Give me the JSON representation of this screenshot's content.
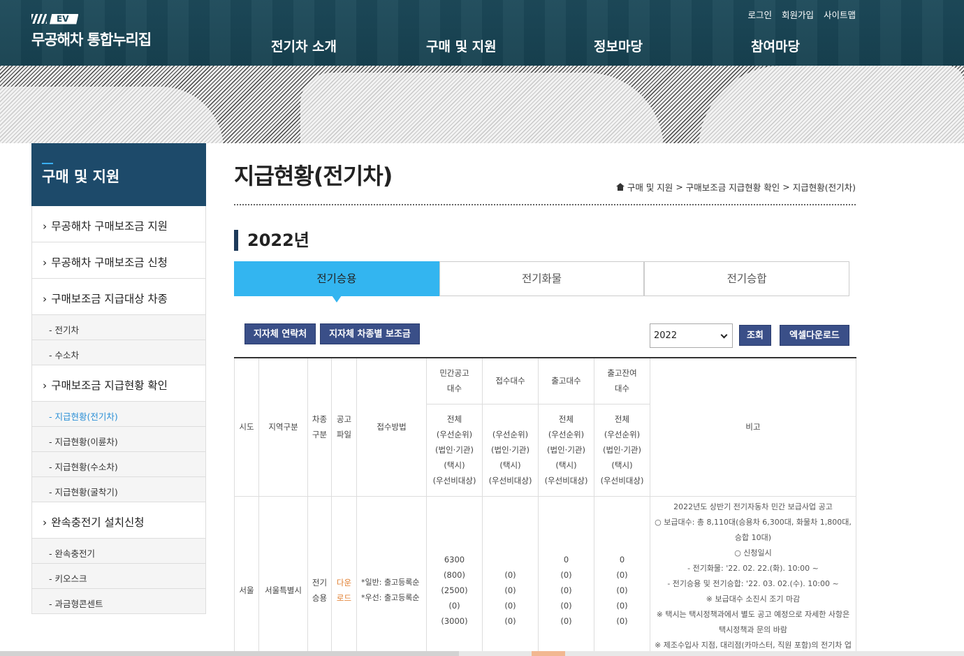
{
  "header": {
    "logo_badge": "EV",
    "logo_text": "무공해차 통합누리집",
    "util_links": [
      "로그인",
      "회원가입",
      "사이트맵"
    ],
    "gnb": [
      "전기차 소개",
      "구매 및 지원",
      "정보마당",
      "참여마당"
    ]
  },
  "sidebar": {
    "title": "구매 및 지원",
    "items": [
      {
        "label": "무공해차 구매보조금 지원"
      },
      {
        "label": "무공해차 구매보조금 신청"
      },
      {
        "label": "구매보조금 지급대상 차종"
      },
      {
        "label": "- 전기차"
      },
      {
        "label": "- 수소차"
      },
      {
        "label": "구매보조금 지급현황 확인"
      },
      {
        "label": "- 지급현황(전기차)"
      },
      {
        "label": "- 지급현황(이륜차)"
      },
      {
        "label": "- 지급현황(수소차)"
      },
      {
        "label": "- 지급현황(굴착기)"
      },
      {
        "label": "완속충전기 설치신청"
      },
      {
        "label": "- 완속충전기"
      },
      {
        "label": "- 키오스크"
      },
      {
        "label": "- 과금형콘센트"
      }
    ]
  },
  "page": {
    "title": "지급현황(전기차)",
    "breadcrumb": [
      "구매 및 지원",
      "구매보조금 지급현황 확인",
      "지급현황(전기차)"
    ],
    "breadcrumb_sep": ">",
    "year_heading": "2022년"
  },
  "tabs": [
    "전기승용",
    "전기화물",
    "전기승합"
  ],
  "toolbar": {
    "contact_button": "지자체 연락처",
    "subsidy_button": "지자체 차종별 보조금",
    "year_select": "2022",
    "search_button": "조회",
    "excel_button": "엑셀다운로드"
  },
  "table": {
    "headers": {
      "sido": "시도",
      "region": "지역구분",
      "type_a": "차종",
      "type_b": "구분",
      "file_a": "공고",
      "file_b": "파일",
      "method": "접수방법",
      "public_a": "민간공고",
      "public_b": "대수",
      "received": "접수대수",
      "released": "출고대수",
      "remain_a": "출고잔여",
      "remain_b": "대수",
      "note": "비고"
    },
    "sub_header": [
      "전체",
      "(우선순위)",
      "(법인·기관)",
      "(택시)",
      "(우선비대상)"
    ],
    "row": {
      "sido": "서울",
      "region": "서울특별시",
      "type_a": "전기",
      "type_b": "승용",
      "file_a": "다운",
      "file_b": "로드",
      "method": [
        "*일반: 출고등록순",
        "*우선: 출고등록순"
      ],
      "public": [
        "6300",
        "(800)",
        "(2500)",
        "(0)",
        "(3000)"
      ],
      "received": [
        "(0)",
        "(0)",
        "(0)",
        "(0)"
      ],
      "released": [
        "0",
        "(0)",
        "(0)",
        "(0)",
        "(0)"
      ],
      "remain": [
        "0",
        "(0)",
        "(0)",
        "(0)",
        "(0)"
      ],
      "note": [
        "2022년도 상반기 전기자동차 민간 보급사업 공고",
        "○ 보급대수: 총 8,110대(승용차 6,300대, 화물차 1,800대,",
        "승합 10대)",
        "○ 신청일시",
        "- 전기화물: '22. 02. 22.(화). 10:00 ~",
        "- 전기승용 및 전기승합: '22. 03. 02.(수). 10:00 ~",
        "※ 보급대수 소진시 조기 마감",
        "※ 택시는 택시정책과에서 별도 공고 예정으로 자세한 사항은",
        "택시정책과 문의 바람",
        "※ 제조수입사 지점, 대리점(카마스터, 직원 포함)의 전기차 업"
      ]
    }
  }
}
